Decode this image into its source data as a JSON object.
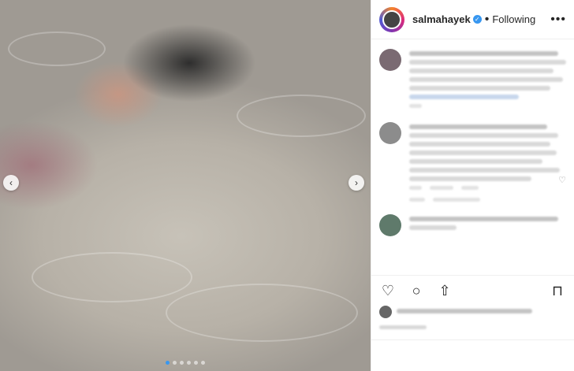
{
  "post": {
    "username": "salmahayek",
    "verified": true,
    "follow_separator": "•",
    "follow_status": "Following",
    "more_glyph": "•••"
  },
  "media": {
    "prev_glyph": "‹",
    "next_glyph": "›",
    "pages": 6,
    "active_page": 1
  },
  "icons": {
    "like": "heart-icon",
    "comment": "comment-icon",
    "share": "share-icon",
    "save": "bookmark-icon"
  },
  "colors": {
    "accent": "#3897f0",
    "text": "#262626",
    "border": "#efefef"
  }
}
